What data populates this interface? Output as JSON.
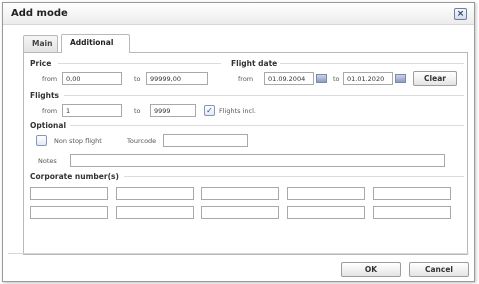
{
  "dialog": {
    "title": "Add mode",
    "close_glyph": "×"
  },
  "tabs": [
    {
      "label": "Main",
      "active": false
    },
    {
      "label": "Additional",
      "active": true
    }
  ],
  "price": {
    "title": "Price",
    "from_label": "from",
    "from_value": "0,00",
    "to_label": "to",
    "to_value": "99999,00"
  },
  "flight_date": {
    "title": "Flight date",
    "from_label": "from",
    "from_value": "01.09.2004",
    "to_label": "to",
    "to_value": "01.01.2020",
    "clear_label": "Clear",
    "calendar_icon": "calendar-icon"
  },
  "flights": {
    "title": "Flights",
    "from_label": "from",
    "from_value": "1",
    "to_label": "to",
    "to_value": "9999",
    "incl_label": "Flights incl.",
    "incl_checked": true
  },
  "optional": {
    "title": "Optional",
    "non_stop_label": "Non stop flight",
    "non_stop_checked": false,
    "tourcode_label": "Tourcode",
    "tourcode_value": "",
    "notes_label": "Notes",
    "notes_value": ""
  },
  "corporate": {
    "title": "Corporate number(s)",
    "rows": [
      [
        "",
        "",
        "",
        "",
        ""
      ],
      [
        "",
        "",
        "",
        "",
        ""
      ]
    ]
  },
  "footer": {
    "ok_label": "OK",
    "cancel_label": "Cancel"
  }
}
